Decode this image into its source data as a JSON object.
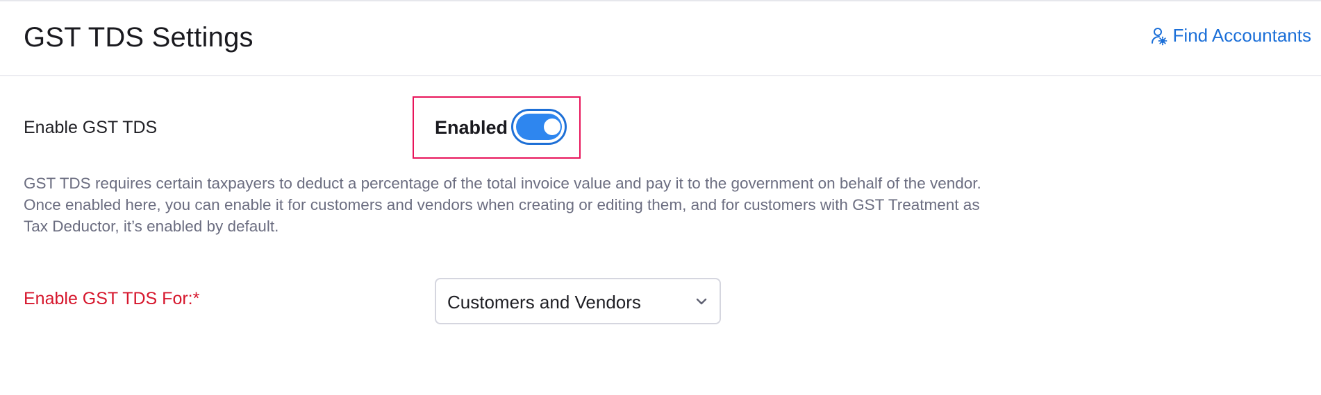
{
  "header": {
    "title": "GST TDS Settings",
    "find_accountants_label": "Find Accountants",
    "find_accountants_icon": "user-search-icon",
    "link_color": "#1b6fd8"
  },
  "enable_gst_tds": {
    "label": "Enable GST TDS",
    "status_text": "Enabled",
    "toggle_on": true,
    "toggle_color": "#2e86ef",
    "highlight_color": "#e8145a"
  },
  "description": "GST TDS requires certain taxpayers to deduct a percentage of the total invoice value and pay it to the government on behalf of the vendor. Once enabled here, you can enable it for customers and vendors when creating or editing them, and for customers with GST Treatment as Tax Deductor, it’s enabled by default.",
  "enable_for": {
    "label": "Enable GST TDS For:*",
    "label_color": "#d6162c",
    "selected_value": "Customers and Vendors",
    "dropdown_icon": "chevron-down-icon"
  }
}
